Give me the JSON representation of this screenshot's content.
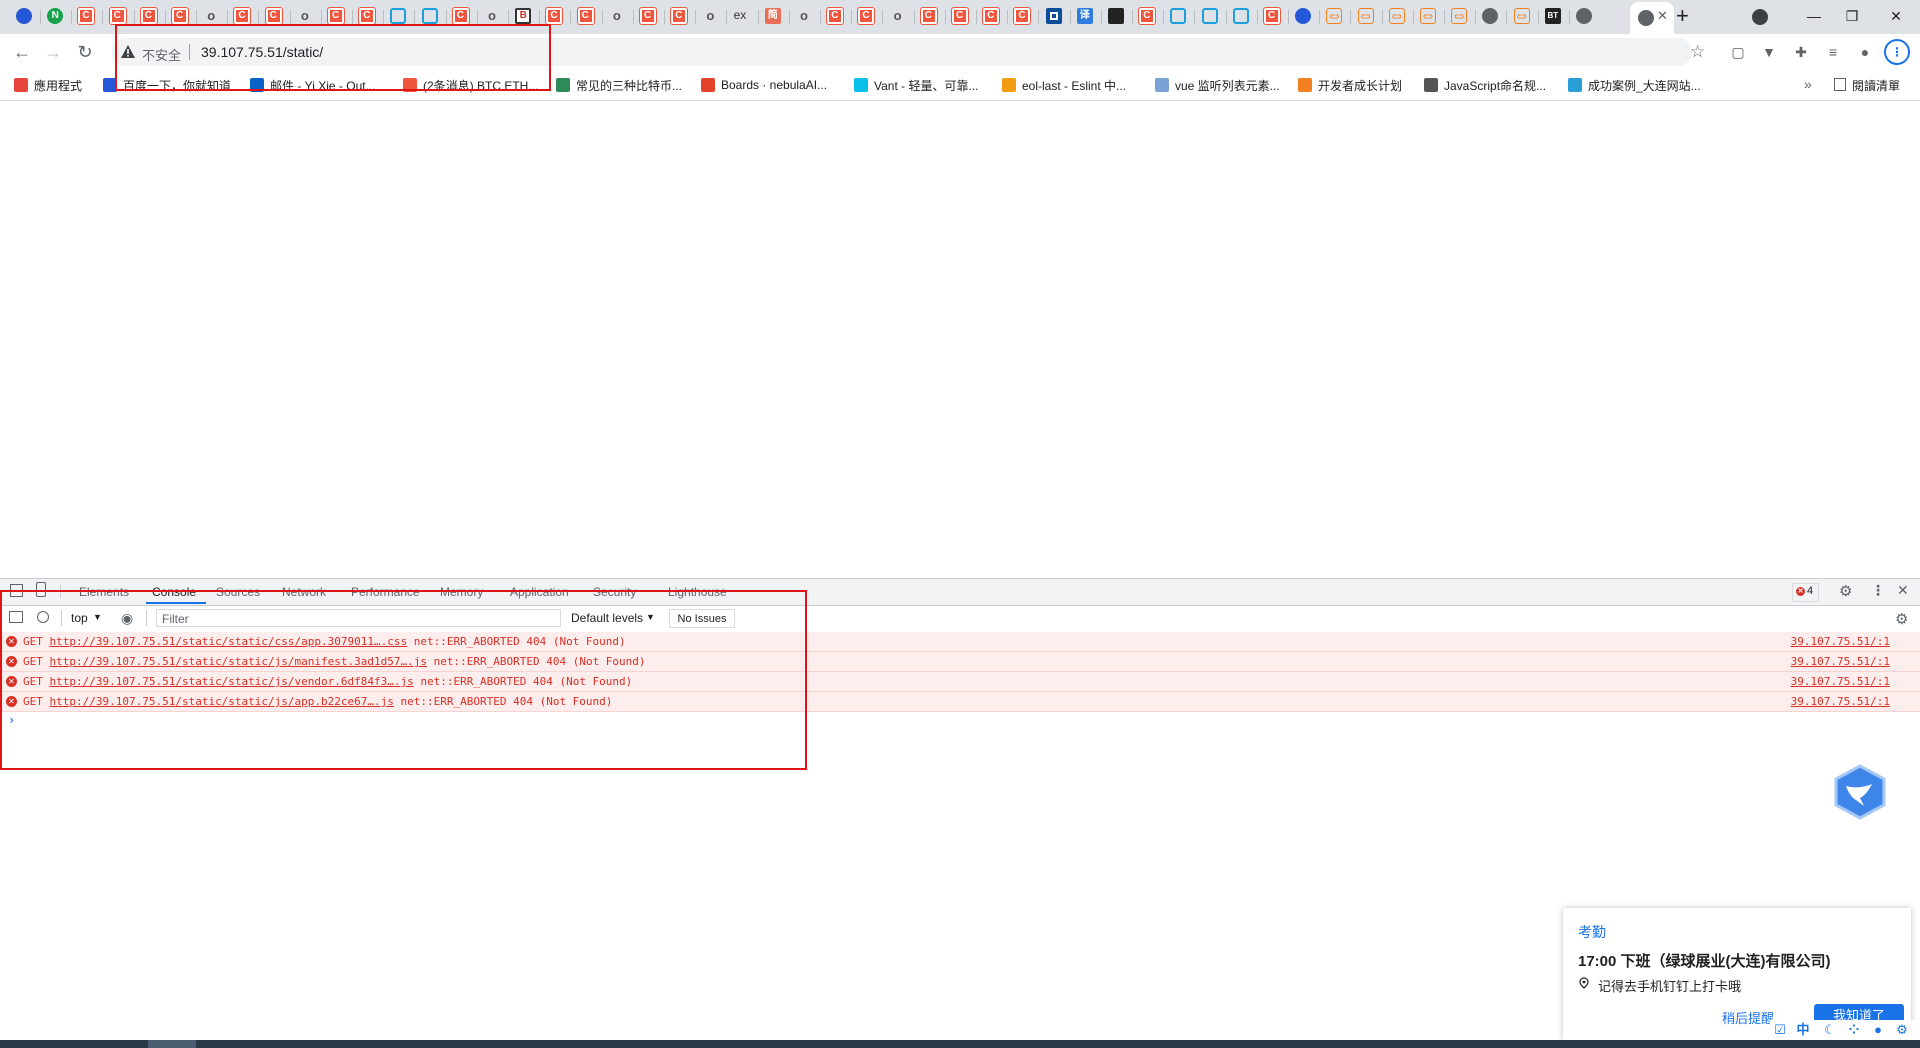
{
  "tabs": {
    "active_close": "✕",
    "new_tab": "+",
    "icons": [
      "paw-icon",
      "n-icon",
      "csdn-icon",
      "csdn-icon",
      "csdn-icon",
      "csdn-icon",
      "o-icon",
      "csdn-icon",
      "csdn-icon",
      "o-icon",
      "csdn-icon",
      "csdn-icon",
      "bilibili-icon",
      "bilibili-icon",
      "csdn-icon",
      "o-icon",
      "b-icon",
      "csdn-icon",
      "csdn-icon",
      "o-icon",
      "csdn-icon",
      "csdn-icon",
      "o-icon",
      "ex-icon",
      "jian-icon",
      "o-icon",
      "csdn-icon",
      "csdn-icon",
      "o-icon",
      "csdn-icon",
      "csdn-icon",
      "csdn-icon",
      "csdn-icon",
      "box-icon",
      "translate-icon",
      "dark-icon",
      "csdn-icon",
      "bilibili-icon",
      "bilibili-icon",
      "bilibili-icon",
      "csdn-icon",
      "paw-icon",
      "link-icon",
      "link-icon",
      "link-icon",
      "link-icon",
      "link-icon",
      "globe-icon",
      "link-icon",
      "bt-icon",
      "globe-icon"
    ],
    "ex_label": "ex",
    "bt_label": "BT"
  },
  "window": {
    "minimize": "—",
    "restore": "❐",
    "close": "✕"
  },
  "toolbar": {
    "security_label": "不安全",
    "url": "39.107.75.51/static/"
  },
  "bookmarks": [
    {
      "label": "應用程式",
      "color": "#e8453c"
    },
    {
      "label": "百度一下，你就知道",
      "color": "#2458d6"
    },
    {
      "label": "邮件 - Yi Xie - Out...",
      "color": "#0a64c8"
    },
    {
      "label": "(2条消息) BTC ETH...",
      "color": "#f0553d"
    },
    {
      "label": "常见的三种比特币...",
      "color": "#2e8b57"
    },
    {
      "label": "Boards · nebulaAI...",
      "color": "#e2432a"
    },
    {
      "label": "Vant - 轻量、可靠...",
      "color": "#07c0ea"
    },
    {
      "label": "eol-last - Eslint 中...",
      "color": "#f39c12"
    },
    {
      "label": "vue 监听列表元素...",
      "color": "#7aa2d6"
    },
    {
      "label": "开发者成长计划",
      "color": "#f08020"
    },
    {
      "label": "JavaScript命名规...",
      "color": "#555555"
    },
    {
      "label": "成功案例_大连网站...",
      "color": "#2a9fd6"
    }
  ],
  "bookmarks_more": "»",
  "reading_list": "閱讀清單",
  "devtools": {
    "tabs": [
      "Elements",
      "Console",
      "Sources",
      "Network",
      "Performance",
      "Memory",
      "Application",
      "Security",
      "Lighthouse"
    ],
    "error_count": "4",
    "context": "top",
    "filter_placeholder": "Filter",
    "levels": "Default levels",
    "issues": "No Issues",
    "errors": [
      {
        "method": "GET",
        "url": "http://39.107.75.51/static/static/css/app.3079011….css",
        "status": "net::ERR_ABORTED 404 (Not Found)",
        "source": "39.107.75.51/:1"
      },
      {
        "method": "GET",
        "url": "http://39.107.75.51/static/static/js/manifest.3ad1d57….js",
        "status": "net::ERR_ABORTED 404 (Not Found)",
        "source": "39.107.75.51/:1"
      },
      {
        "method": "GET",
        "url": "http://39.107.75.51/static/static/js/vendor.6df84f3….js",
        "status": "net::ERR_ABORTED 404 (Not Found)",
        "source": "39.107.75.51/:1"
      },
      {
        "method": "GET",
        "url": "http://39.107.75.51/static/static/js/app.b22ce67….js",
        "status": "net::ERR_ABORTED 404 (Not Found)",
        "source": "39.107.75.51/:1"
      }
    ],
    "prompt": "›"
  },
  "notification": {
    "app": "考勤",
    "title": "17:00 下班（绿球展业(大连)有限公司)",
    "body": "记得去手机钉钉上打卡哦",
    "later": "稍后提醒 ⌄",
    "ok": "我知道了"
  },
  "tray": {
    "ime": "中"
  },
  "colors": {
    "error_red": "#d93025",
    "annotation_red": "#e01616",
    "accent_blue": "#1a73e8"
  }
}
